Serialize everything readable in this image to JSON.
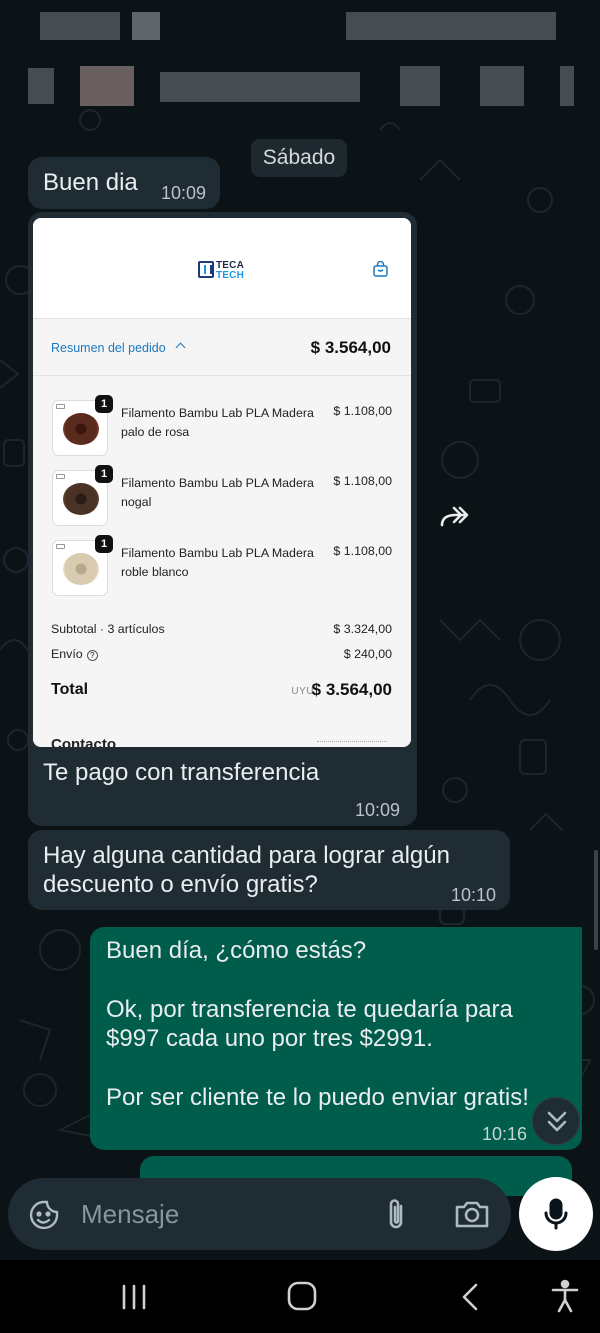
{
  "chat": {
    "day_chip": "Sábado",
    "messages": [
      {
        "text": "Buen dia",
        "time": "10:09"
      },
      {
        "text": "Te pago con transferencia",
        "time": "10:09"
      },
      {
        "text": "Hay alguna cantidad para lograr algún",
        "text2": "descuento o envío gratis?",
        "time": "10:10"
      }
    ],
    "outgoing": {
      "line1": "Buen día, ¿cómo estás?",
      "line2": "Ok, por transferencia te quedaría para",
      "line3": "$997 cada uno por tres $2991.",
      "line4": "Por ser cliente te lo puedo enviar gratis!",
      "time": "10:16"
    }
  },
  "screenshot": {
    "logo_line1": "TECA",
    "logo_line2": "TECH",
    "summary_link": "Resumen del pedido",
    "summary_total": "$ 3.564,00",
    "items": [
      {
        "qty": "1",
        "name": "Filamento Bambu Lab PLA Madera palo de rosa",
        "price": "$ 1.108,00",
        "color": "#5a2a1c"
      },
      {
        "qty": "1",
        "name": "Filamento Bambu Lab PLA Madera nogal",
        "price": "$ 1.108,00",
        "color": "#4a3326"
      },
      {
        "qty": "1",
        "name": "Filamento Bambu Lab PLA Madera roble blanco",
        "price": "$ 1.108,00",
        "color": "#d8cbb0"
      }
    ],
    "subtotal_label": "Subtotal · 3 artículos",
    "subtotal_value": "$ 3.324,00",
    "shipping_label": "Envío",
    "shipping_value": "$ 240,00",
    "total_label": "Total",
    "total_currency": "UYU",
    "total_value": "$ 3.564,00",
    "cut_text": "Contacto"
  },
  "composer": {
    "placeholder": "Mensaje"
  },
  "icons": {
    "emoji": "sticker-icon",
    "attach": "paperclip-icon",
    "camera": "camera-icon",
    "mic": "microphone-icon",
    "forward": "forward-icon",
    "scroll": "double-chevron-down-icon"
  },
  "colors": {
    "background": "#0c1317",
    "incoming_bubble": "#202c33",
    "outgoing_bubble": "#005c4b",
    "link_blue": "#1a78c2"
  }
}
